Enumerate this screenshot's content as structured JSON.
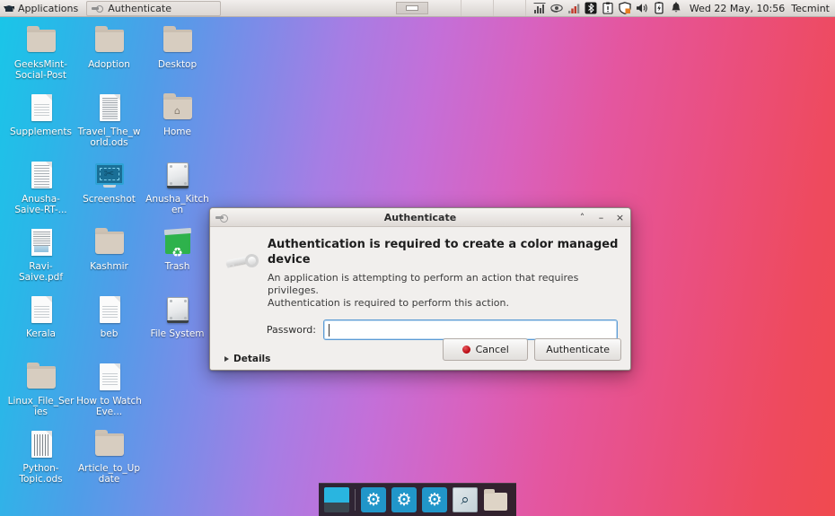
{
  "panel": {
    "menu_label": "Applications",
    "menu_icon": "linuxmint-logo-icon",
    "window_button": {
      "label": "Authenticate",
      "icon": "key-icon"
    },
    "tray_icons": [
      {
        "name": "system-monitor-icon",
        "glyph": "ὌA"
      },
      {
        "name": "nvidia-settings-icon",
        "glyph": "eye"
      },
      {
        "name": "network-signal-icon",
        "glyph": "bars"
      },
      {
        "name": "bluetooth-icon",
        "glyph": "B"
      },
      {
        "name": "clipboard-manager-icon",
        "glyph": "clipboard"
      },
      {
        "name": "update-manager-shield-icon",
        "glyph": "shield"
      },
      {
        "name": "volume-icon",
        "glyph": "speaker"
      },
      {
        "name": "battery-icon",
        "glyph": "battery"
      },
      {
        "name": "notifications-bell-icon",
        "glyph": "bell"
      }
    ],
    "clock": "Wed 22 May, 10:56",
    "user": "Tecmint"
  },
  "desktop": {
    "icons": [
      {
        "label": "GeeksMint-Social-Post",
        "type": "folder"
      },
      {
        "label": "Adoption",
        "type": "folder"
      },
      {
        "label": "Desktop",
        "type": "folder"
      },
      {
        "label": "Supplements",
        "type": "document"
      },
      {
        "label": "Travel_The_world.ods",
        "type": "spreadsheet"
      },
      {
        "label": "Home",
        "type": "home-folder"
      },
      {
        "label": "Anusha-Saive-RT-...",
        "type": "text-document"
      },
      {
        "label": "Screenshot",
        "type": "screenshot-tool"
      },
      {
        "label": "Anusha_Kitchen",
        "type": "drive"
      },
      {
        "label": "Ravi-Saive.pdf",
        "type": "pdf"
      },
      {
        "label": "Kashmir",
        "type": "folder"
      },
      {
        "label": "Trash",
        "type": "trash"
      },
      {
        "label": "Kerala",
        "type": "document"
      },
      {
        "label": "beb",
        "type": "document"
      },
      {
        "label": "File System",
        "type": "drive"
      },
      {
        "label": "Linux_File_Series",
        "type": "folder"
      },
      {
        "label": "How to Watch Eve...",
        "type": "document"
      },
      {
        "label": "",
        "type": "blank"
      },
      {
        "label": "Python-Topic.ods",
        "type": "spreadsheet"
      },
      {
        "label": "Article_to_Update",
        "type": "folder"
      },
      {
        "label": "",
        "type": "blank"
      }
    ]
  },
  "dialog": {
    "title": "Authenticate",
    "title_icon": "key-icon",
    "controls": {
      "shade": "˄",
      "minimize": "–",
      "close": "×"
    },
    "icon": "key-icon",
    "heading": "Authentication is required to create a color managed device",
    "description_line1": "An application is attempting to perform an action that requires privileges.",
    "description_line2": "Authentication is required to perform this action.",
    "password_label": "Password:",
    "password_value": "",
    "password_placeholder": "",
    "details_label": "Details",
    "cancel_label": "Cancel",
    "authenticate_label": "Authenticate"
  },
  "dock": {
    "items": [
      {
        "name": "show-desktop",
        "type": "desktop"
      },
      {
        "name": "separator",
        "type": "separator"
      },
      {
        "name": "settings-1",
        "type": "gear",
        "glyph": "⚙"
      },
      {
        "name": "settings-2",
        "type": "gear",
        "glyph": "⚙"
      },
      {
        "name": "settings-3",
        "type": "gear",
        "glyph": "⚙"
      },
      {
        "name": "search",
        "type": "search",
        "glyph": "⌕"
      },
      {
        "name": "files",
        "type": "folder"
      }
    ]
  },
  "colors": {
    "accent_blue": "#2196c9",
    "dialog_bg": "#f1efed",
    "focus_border": "#5b9bd5",
    "cancel_dot": "#b2000a"
  }
}
